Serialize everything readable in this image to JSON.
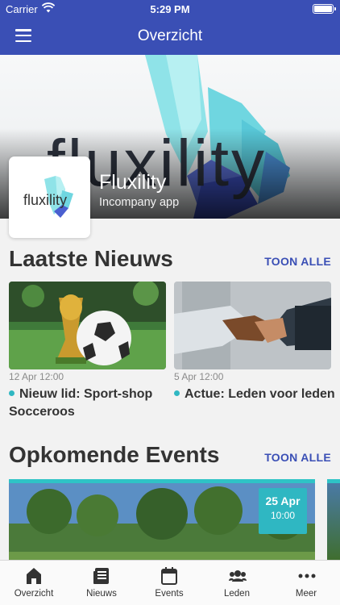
{
  "status_bar": {
    "carrier": "Carrier",
    "time": "5:29 PM"
  },
  "nav": {
    "title": "Overzicht",
    "menu_icon": "hamburger-menu-icon"
  },
  "app": {
    "name": "Fluxility",
    "subtitle": "Incompany app",
    "hero_wordmark": "fluxility",
    "logo_text": "fluxility"
  },
  "news_section": {
    "title": "Laatste Nieuws",
    "show_all": "TOON ALLE",
    "items": [
      {
        "date": "12 Apr 12:00",
        "headline": "Nieuw lid: Sport-shop Socceroos"
      },
      {
        "date": "5 Apr 12:00",
        "headline": "Actue: Leden voor leden"
      }
    ]
  },
  "events_section": {
    "title": "Opkomende Events",
    "show_all": "TOON ALLE",
    "items": [
      {
        "day": "25 Apr",
        "time": "10:00"
      }
    ]
  },
  "tabbar": {
    "tabs": [
      {
        "label": "Overzicht",
        "icon": "home-icon"
      },
      {
        "label": "Nieuws",
        "icon": "news-icon"
      },
      {
        "label": "Events",
        "icon": "calendar-icon"
      },
      {
        "label": "Leden",
        "icon": "members-icon"
      },
      {
        "label": "Meer",
        "icon": "more-icon"
      }
    ]
  },
  "colors": {
    "primary": "#3a4fb5",
    "accent": "#2fb7c2"
  }
}
